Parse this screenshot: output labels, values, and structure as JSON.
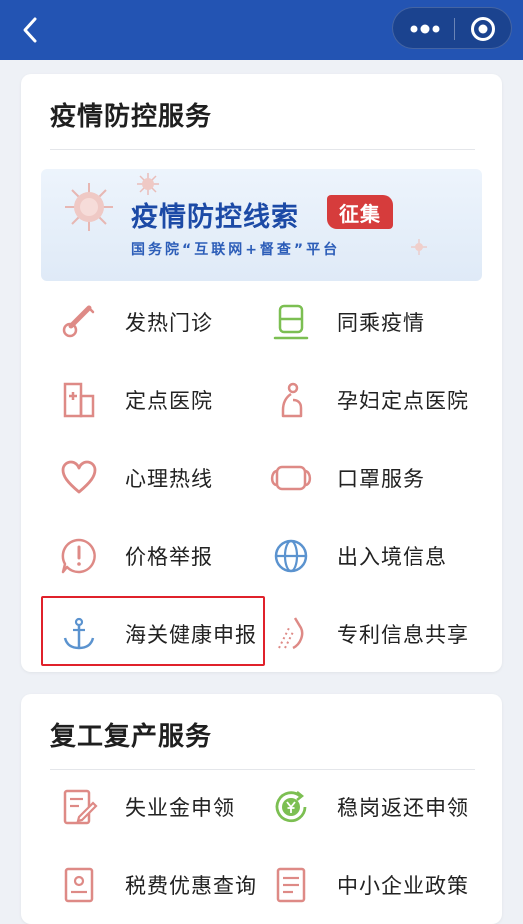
{
  "header": {
    "back_icon": "chevron-left-icon",
    "more_icon": "more-dots-icon",
    "close_icon": "target-circle-icon",
    "bg_color": "#2354b3"
  },
  "epidemic": {
    "title": "疫情防控服务",
    "banner": {
      "title": "疫情防控线索",
      "badge": "征集",
      "subtitle": "国务院“互联网+督查”平台"
    },
    "items": [
      {
        "label": "发热门诊",
        "icon": "thermometer-icon"
      },
      {
        "label": "同乘疫情",
        "icon": "train-icon"
      },
      {
        "label": "定点医院",
        "icon": "hospital-icon"
      },
      {
        "label": "孕妇定点医院",
        "icon": "pregnant-icon"
      },
      {
        "label": "心理热线",
        "icon": "heart-icon"
      },
      {
        "label": "口罩服务",
        "icon": "mask-icon"
      },
      {
        "label": "价格举报",
        "icon": "alert-icon"
      },
      {
        "label": "出入境信息",
        "icon": "globe-icon"
      },
      {
        "label": "海关健康申报",
        "icon": "anchor-icon"
      },
      {
        "label": "专利信息共享",
        "icon": "patent-icon"
      }
    ]
  },
  "resume": {
    "title": "复工复产服务",
    "items": [
      {
        "label": "失业金申领",
        "icon": "form-edit-icon"
      },
      {
        "label": "稳岗返还申领",
        "icon": "yuan-refresh-icon"
      },
      {
        "label": "税费优惠查询",
        "icon": "tax-doc-icon"
      },
      {
        "label": "中小企业政策",
        "icon": "document-lines-icon"
      }
    ]
  },
  "colors": {
    "accent_blue": "#2354b3",
    "icon_red": "#de8a86",
    "icon_green": "#7cbf52",
    "icon_blue": "#5b93cf",
    "highlight_red": "#e0212b"
  }
}
